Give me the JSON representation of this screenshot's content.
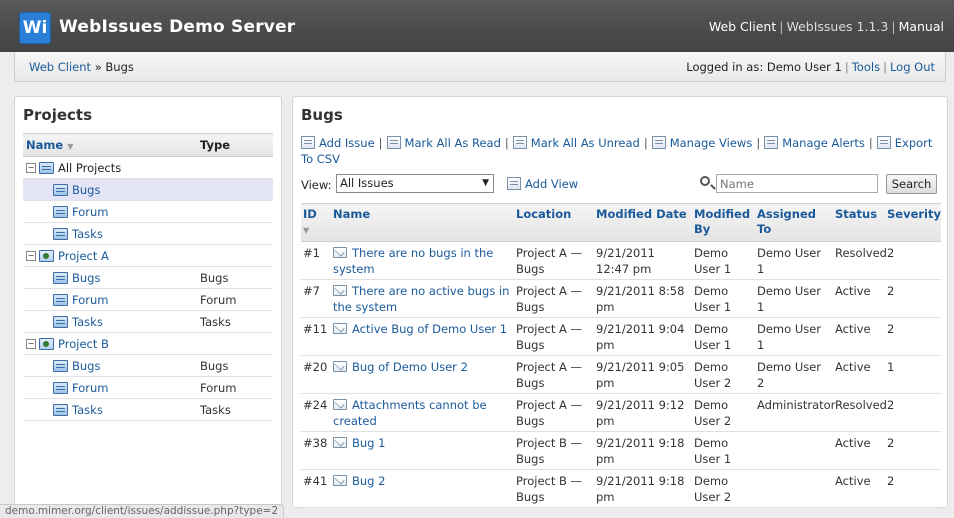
{
  "header": {
    "logo_text": "Wi",
    "title": "WebIssues Demo Server",
    "links": [
      "Web Client",
      "WebIssues 1.1.3",
      "Manual"
    ]
  },
  "crumbs": {
    "root": "Web Client",
    "separator": "»",
    "current": "Bugs"
  },
  "login": {
    "text": "Logged in as: Demo User 1",
    "tools": "Tools",
    "logout": "Log Out"
  },
  "projects": {
    "title": "Projects",
    "col_name": "Name",
    "col_type": "Type",
    "rows": [
      {
        "label": "All Projects",
        "type": "",
        "level": 0,
        "expander": "−",
        "icon": "all-projects-icon",
        "link": false
      },
      {
        "label": "Bugs",
        "type": "",
        "level": 1,
        "icon": "folder-icon",
        "link": true,
        "selected": true
      },
      {
        "label": "Forum",
        "type": "",
        "level": 1,
        "icon": "folder-icon",
        "link": true
      },
      {
        "label": "Tasks",
        "type": "",
        "level": 1,
        "icon": "folder-icon",
        "link": true
      },
      {
        "label": "Project A",
        "type": "",
        "level": 0,
        "expander": "−",
        "icon": "project-icon",
        "link": true
      },
      {
        "label": "Bugs",
        "type": "Bugs",
        "level": 1,
        "icon": "folder-icon",
        "link": true
      },
      {
        "label": "Forum",
        "type": "Forum",
        "level": 1,
        "icon": "folder-icon",
        "link": true
      },
      {
        "label": "Tasks",
        "type": "Tasks",
        "level": 1,
        "icon": "folder-icon",
        "link": true
      },
      {
        "label": "Project B",
        "type": "",
        "level": 0,
        "expander": "−",
        "icon": "project-icon",
        "link": true
      },
      {
        "label": "Bugs",
        "type": "Bugs",
        "level": 1,
        "icon": "folder-icon",
        "link": true
      },
      {
        "label": "Forum",
        "type": "Forum",
        "level": 1,
        "icon": "folder-icon",
        "link": true
      },
      {
        "label": "Tasks",
        "type": "Tasks",
        "level": 1,
        "icon": "folder-icon",
        "link": true
      }
    ]
  },
  "bugs": {
    "title": "Bugs",
    "toolbar": [
      {
        "label": "Add Issue",
        "icon": "add-issue-icon"
      },
      {
        "label": "Mark All As Read",
        "icon": "mark-read-icon"
      },
      {
        "label": "Mark All As Unread",
        "icon": "mark-unread-icon"
      },
      {
        "label": "Manage Views",
        "icon": "manage-views-icon"
      },
      {
        "label": "Manage Alerts",
        "icon": "manage-alerts-icon"
      },
      {
        "label": "Export To CSV",
        "icon": "export-icon"
      }
    ],
    "view_label": "View:",
    "view_selected": "All Issues",
    "add_view": "Add View",
    "search_placeholder": "Name",
    "search_button": "Search",
    "columns": [
      "ID",
      "Name",
      "Location",
      "Modified Date",
      "Modified By",
      "Assigned To",
      "Status",
      "Severity"
    ],
    "issues": [
      {
        "id": "#1",
        "name": "There are no bugs in the system",
        "location": "Project A — Bugs",
        "modified_date": "9/21/2011 12:47 pm",
        "modified_by": "Demo User 1",
        "assigned_to": "Demo User 1",
        "status": "Resolved",
        "severity": "2"
      },
      {
        "id": "#7",
        "name": "There are no active bugs in the system",
        "location": "Project A — Bugs",
        "modified_date": "9/21/2011 8:58 pm",
        "modified_by": "Demo User 1",
        "assigned_to": "Demo User 1",
        "status": "Active",
        "severity": "2"
      },
      {
        "id": "#11",
        "name": "Active Bug of Demo User 1",
        "location": "Project A — Bugs",
        "modified_date": "9/21/2011 9:04 pm",
        "modified_by": "Demo User 1",
        "assigned_to": "Demo User 1",
        "status": "Active",
        "severity": "2"
      },
      {
        "id": "#20",
        "name": "Bug of Demo User 2",
        "location": "Project A — Bugs",
        "modified_date": "9/21/2011 9:05 pm",
        "modified_by": "Demo User 2",
        "assigned_to": "Demo User 2",
        "status": "Active",
        "severity": "1"
      },
      {
        "id": "#24",
        "name": "Attachments cannot be created",
        "location": "Project A — Bugs",
        "modified_date": "9/21/2011 9:12 pm",
        "modified_by": "Demo User 2",
        "assigned_to": "Administrator",
        "status": "Resolved",
        "severity": "2"
      },
      {
        "id": "#38",
        "name": "Bug 1",
        "location": "Project B — Bugs",
        "modified_date": "9/21/2011 9:18 pm",
        "modified_by": "Demo User 1",
        "assigned_to": "",
        "status": "Active",
        "severity": "2"
      },
      {
        "id": "#41",
        "name": "Bug 2",
        "location": "Project B — Bugs",
        "modified_date": "9/21/2011 9:18 pm",
        "modified_by": "Demo User 2",
        "assigned_to": "",
        "status": "Active",
        "severity": "2"
      }
    ]
  },
  "status_bar": "demo.mimer.org/client/issues/addissue.php?type=2",
  "colors": {
    "header_bg": "#4a4a4a",
    "logo_blue": "#2b7fd6",
    "link": "#1a5a9a",
    "selected_row": "#e4e4f7"
  }
}
